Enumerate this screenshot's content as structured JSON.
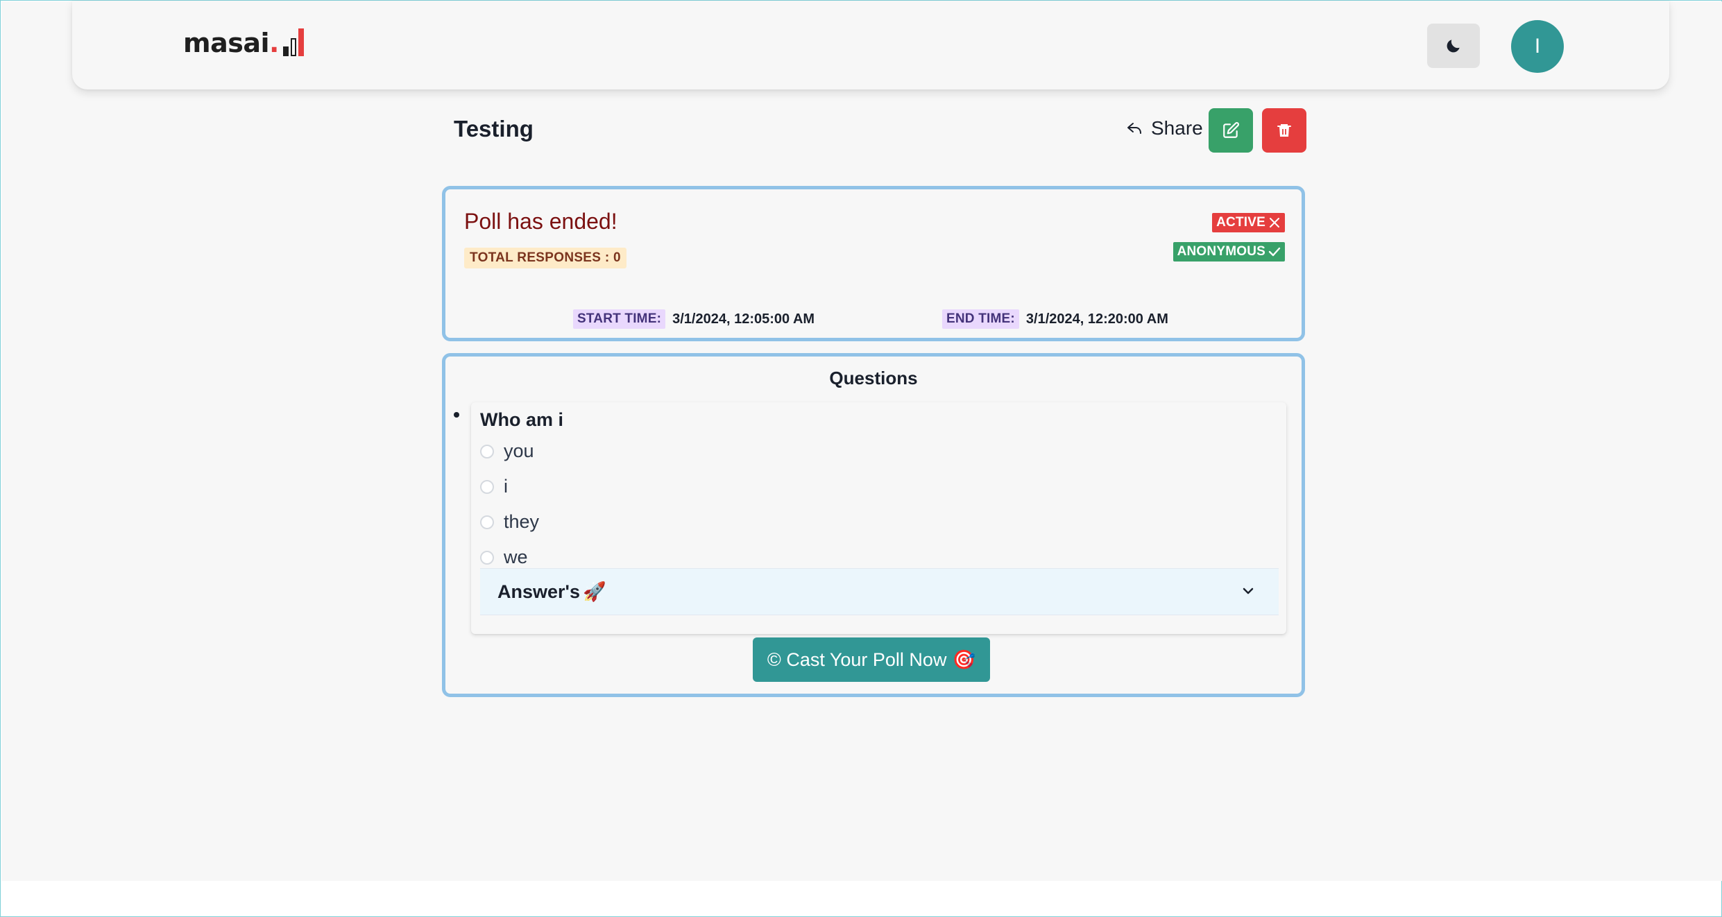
{
  "header": {
    "logo_text": "masai",
    "logo_dot": ".",
    "theme_toggle_icon": "moon-icon",
    "avatar_initial": "I"
  },
  "poll": {
    "title": "Testing",
    "share_label": "Share",
    "status_message": "Poll has ended!",
    "total_responses_label": "TOTAL RESPONSES : 0",
    "active_badge": "ACTIVE",
    "anonymous_badge": "ANONYMOUS",
    "start_time_label": "START TIME:",
    "start_time_value": "3/1/2024, 12:05:00 AM",
    "end_time_label": "END TIME:",
    "end_time_value": "3/1/2024, 12:20:00 AM"
  },
  "questions": {
    "heading": "Questions",
    "items": [
      {
        "text": "Who am i",
        "options": [
          "you",
          "i",
          "they",
          "we"
        ]
      }
    ],
    "answers_label": "Answer's",
    "answers_emoji": "🚀"
  },
  "cast_button": {
    "label": "© Cast Your Poll Now",
    "emoji": "🎯"
  },
  "colors": {
    "accent": "#319795",
    "danger": "#e53e3e",
    "success": "#38a169",
    "card_border": "#90c2e7"
  }
}
